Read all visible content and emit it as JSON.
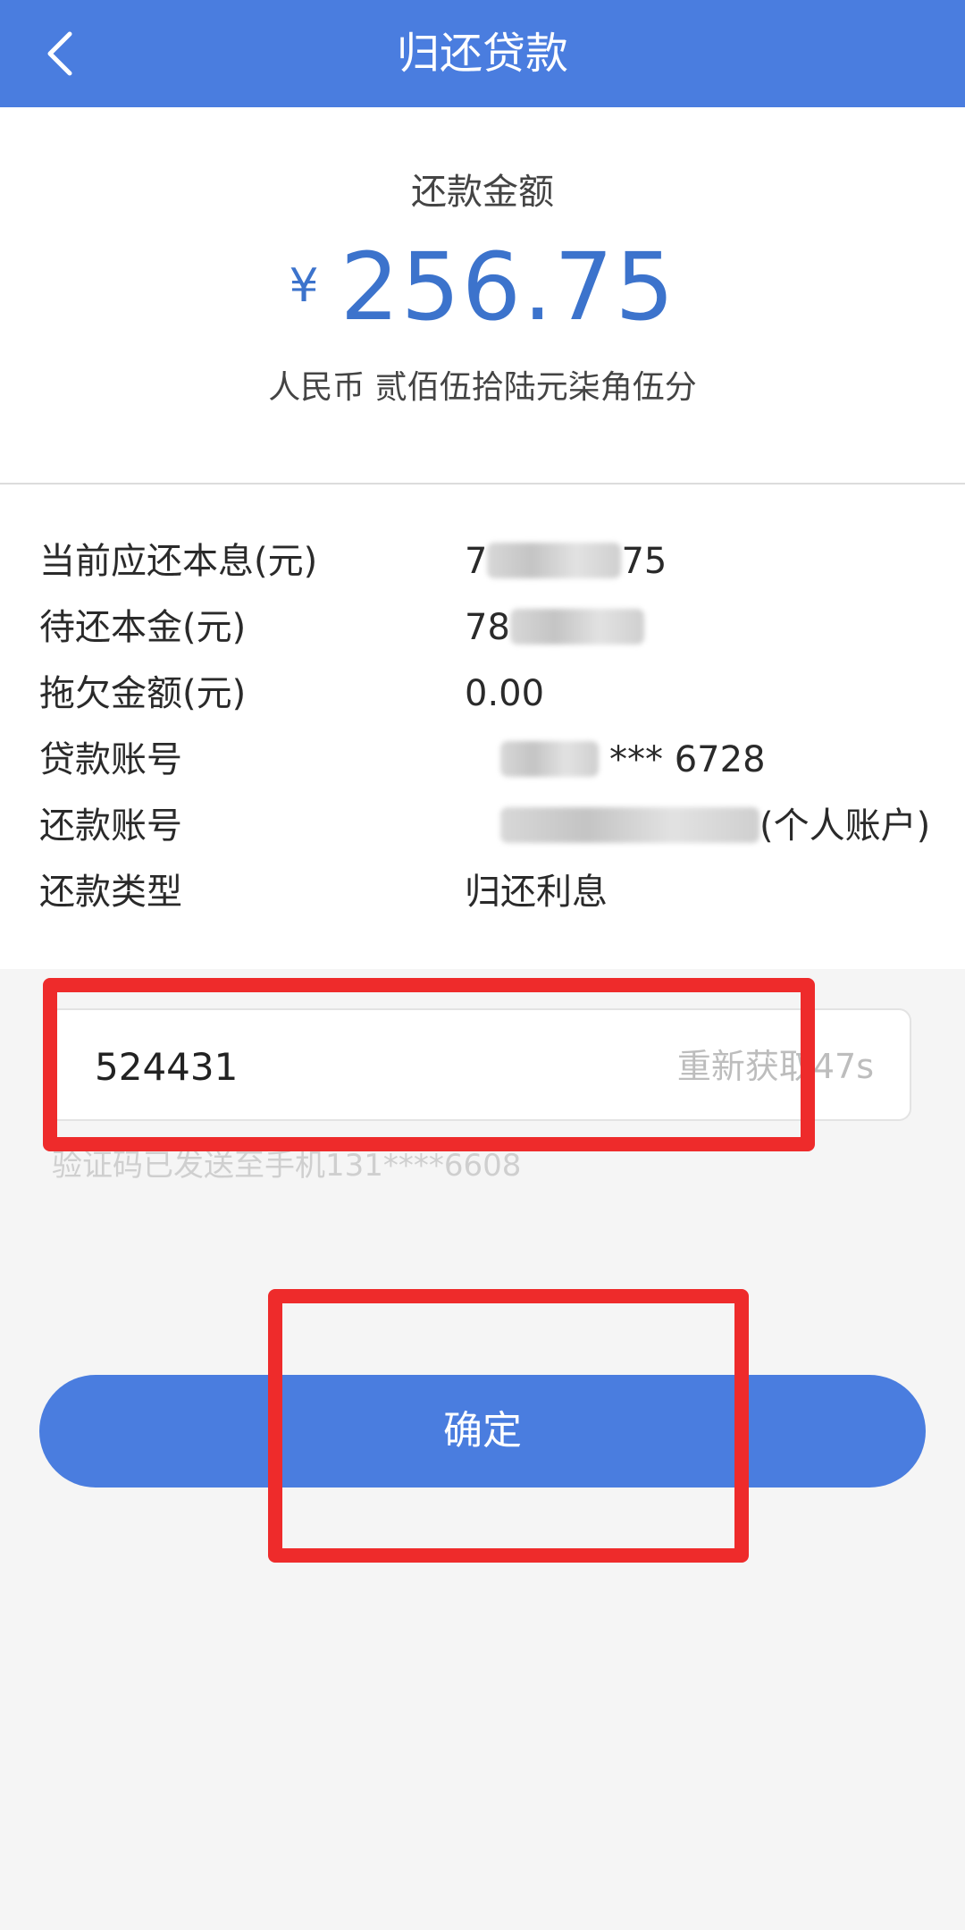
{
  "header": {
    "title": "归还贷款"
  },
  "amount": {
    "label": "还款金额",
    "currency_symbol": "¥",
    "value": "256.75",
    "in_words": "人民币 贰佰伍拾陆元柒角伍分"
  },
  "details": [
    {
      "label": "当前应还本息(元)",
      "value_prefix": "7",
      "value_suffix": "75"
    },
    {
      "label": "待还本金(元)",
      "value_prefix": "78",
      "value_suffix": ""
    },
    {
      "label": "拖欠金额(元)",
      "value_prefix": "0.00",
      "value_suffix": ""
    },
    {
      "label": "贷款账号",
      "value_prefix": "",
      "value_suffix": "*** 6728"
    },
    {
      "label": "还款账号",
      "value_prefix": "",
      "value_suffix": "(个人账户)"
    },
    {
      "label": "还款类型",
      "value_prefix": "归还利息",
      "value_suffix": ""
    }
  ],
  "verification": {
    "code_value": "524431",
    "resend_label": "重新获取47s",
    "hint": "验证码已发送至手机131****6608"
  },
  "confirm_label": "确定",
  "colors": {
    "primary": "#4a7ddf",
    "amount_text": "#3c73cc",
    "highlight": "#ee2b2b"
  }
}
